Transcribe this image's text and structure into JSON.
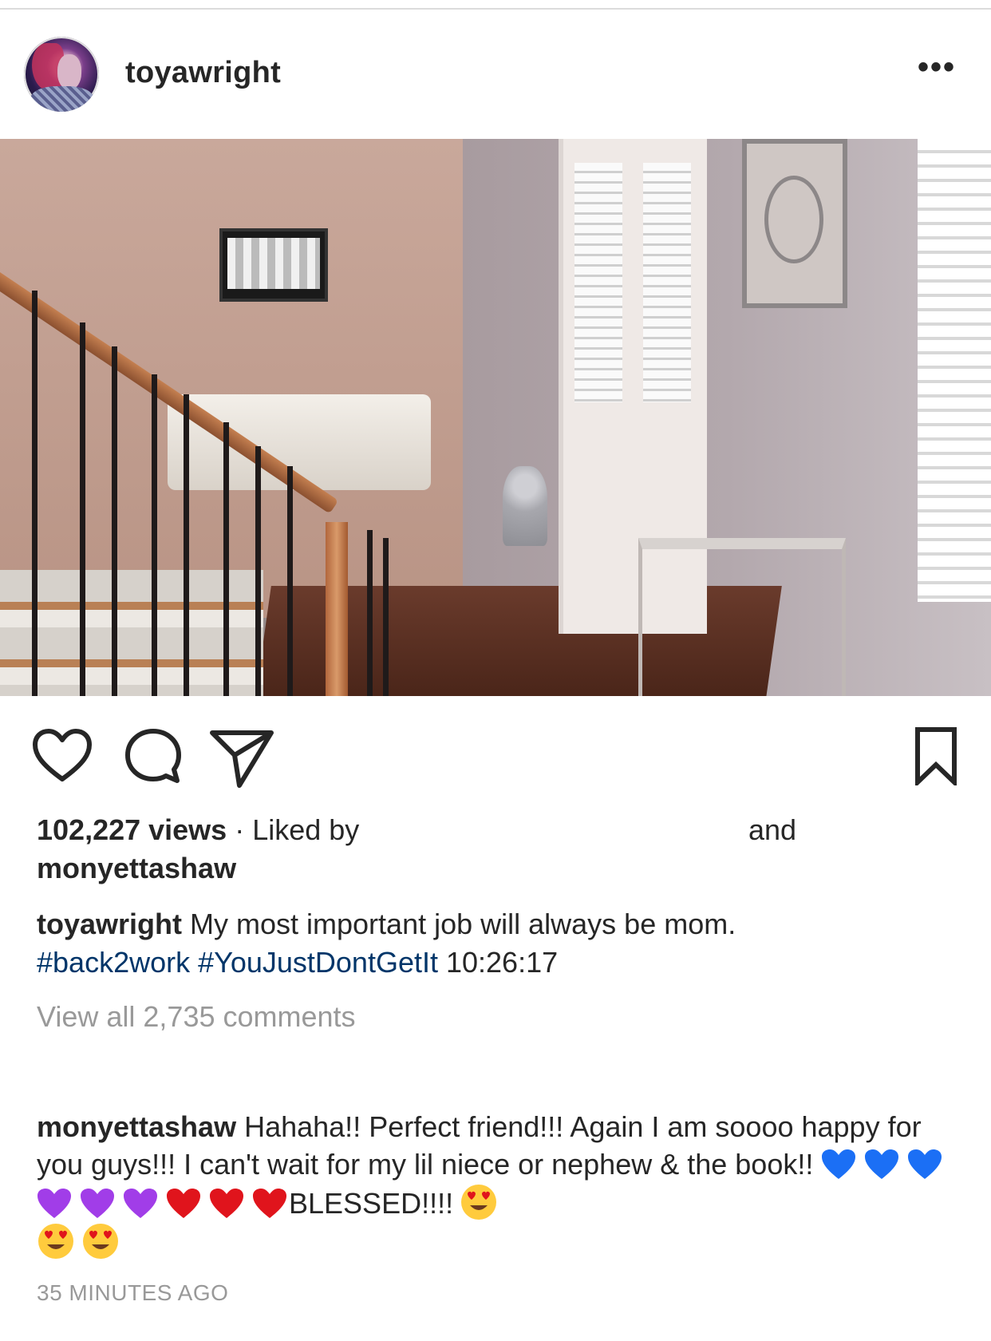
{
  "post": {
    "username": "toyawright",
    "more_label": "•••",
    "views": "102,227 views",
    "liked_by_prefix": " · Liked by",
    "and_label": "and",
    "liked_user": "monyettashaw",
    "caption": {
      "user": "toyawright",
      "text": " My most important job will always be mom.",
      "hashtag1": "#back2work",
      "hashtag2": "#YouJustDontGetIt",
      "time_text": " 10:26:17"
    },
    "view_all_comments": "View all 2,735 comments",
    "comment": {
      "user": "monyettashaw",
      "text": " Hahaha!! Perfect friend!!! Again I am soooo happy for you guys!!! I can't wait for my lil niece or nephew & the book!! ",
      "blessed": "BLESSED!!!!"
    },
    "timestamp": "35 MINUTES AGO"
  },
  "colors": {
    "text": "#262626",
    "hashtag": "#003569",
    "muted": "#999999",
    "heart_blue": "#1b6ff5",
    "heart_purple": "#a13de8",
    "heart_red": "#e0141c"
  },
  "icons": {
    "like": "heart-outline-icon",
    "comment": "speech-bubble-icon",
    "share": "paper-plane-icon",
    "save": "bookmark-icon",
    "more": "ellipsis-icon"
  }
}
